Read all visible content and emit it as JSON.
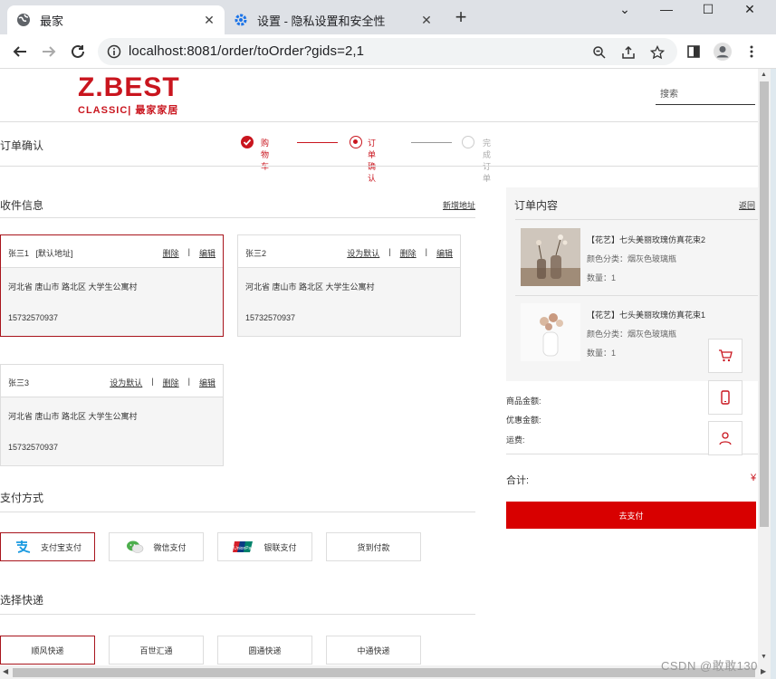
{
  "browser": {
    "tabs": [
      {
        "title": "最家",
        "active": true
      },
      {
        "title": "设置 - 隐私设置和安全性",
        "active": false
      }
    ],
    "url": "localhost:8081/order/toOrder?gids=2,1"
  },
  "header": {
    "logo_main": "Z.BEST",
    "logo_sub": "CLASSIC| 最家家居",
    "search_placeholder": "搜索"
  },
  "order_title": "订单确认",
  "steps": [
    {
      "label": "购物车",
      "state": "done"
    },
    {
      "label": "订单确认",
      "state": "current"
    },
    {
      "label": "完成订单",
      "state": "pending"
    }
  ],
  "shipping": {
    "title": "收件信息",
    "add_link": "新增地址",
    "addresses": [
      {
        "name": "张三1",
        "tag": "[默认地址]",
        "set_default": "",
        "delete": "删除",
        "edit": "编辑",
        "address": "河北省 唐山市 路北区 大学生公寓村",
        "phone": "15732570937",
        "selected": true
      },
      {
        "name": "张三2",
        "tag": "",
        "set_default": "设为默认",
        "delete": "删除",
        "edit": "编辑",
        "address": "河北省 唐山市 路北区 大学生公寓村",
        "phone": "15732570937",
        "selected": false
      },
      {
        "name": "张三3",
        "tag": "",
        "set_default": "设为默认",
        "delete": "删除",
        "edit": "编辑",
        "address": "河北省 唐山市 路北区 大学生公寓村",
        "phone": "15732570937",
        "selected": false
      }
    ]
  },
  "payment": {
    "title": "支付方式",
    "methods": [
      {
        "label": "支付宝支付",
        "icon": "alipay-icon",
        "selected": true
      },
      {
        "label": "微信支付",
        "icon": "wechat-icon",
        "selected": false
      },
      {
        "label": "银联支付",
        "icon": "unionpay-icon",
        "selected": false
      },
      {
        "label": "货到付款",
        "icon": "",
        "selected": false
      }
    ]
  },
  "express": {
    "title": "选择快递",
    "options": [
      {
        "label": "顺风快递",
        "selected": true
      },
      {
        "label": "百世汇通",
        "selected": false
      },
      {
        "label": "圆通快递",
        "selected": false
      },
      {
        "label": "中通快递",
        "selected": false
      }
    ]
  },
  "order": {
    "title": "订单内容",
    "back": "返回",
    "items": [
      {
        "title": "【花艺】七头美丽玫瑰仿真花束2",
        "spec": "颜色分类：烟灰色玻璃瓶",
        "qty": "数量：1"
      },
      {
        "title": "【花艺】七头美丽玫瑰仿真花束1",
        "spec": "颜色分类：烟灰色玻璃瓶",
        "qty": "数量：1"
      }
    ],
    "goods_amount": "商品金额:",
    "discount": "优惠金额:",
    "shipping_fee": "运费:",
    "total_label": "合计:",
    "total_currency": "¥",
    "pay_button": "去支付"
  },
  "watermark": "CSDN @敢敢130",
  "colors": {
    "brand": "#c9151e",
    "pay_button": "#d80000",
    "selected_border": "#a8141c"
  }
}
